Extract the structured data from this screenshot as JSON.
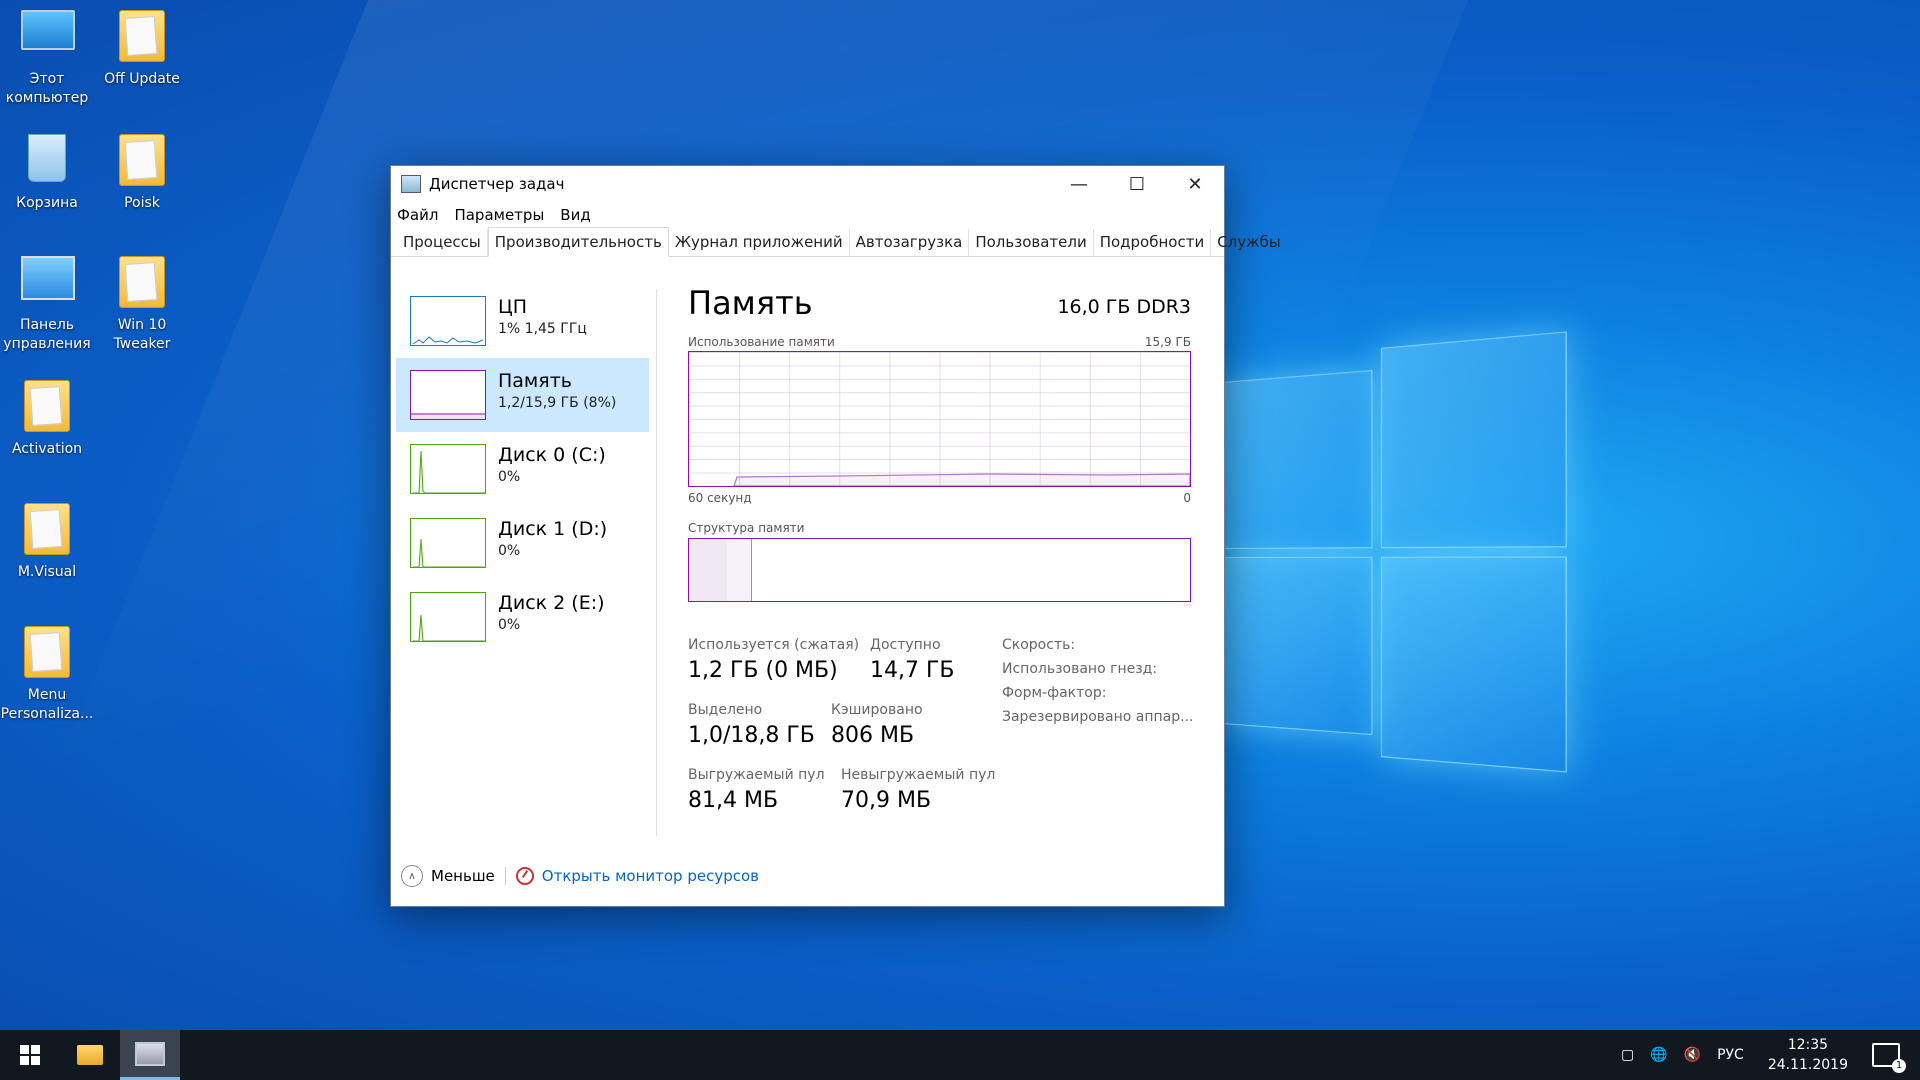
{
  "desktop": {
    "icons": [
      {
        "label": "Этот компьютер",
        "icon": "computer-icon"
      },
      {
        "label": "Off Update",
        "icon": "folder-icon"
      },
      {
        "label": "Корзина",
        "icon": "recycle-bin-icon"
      },
      {
        "label": "Poisk",
        "icon": "folder-icon"
      },
      {
        "label": "Панель управления",
        "icon": "control-panel-icon"
      },
      {
        "label": "Win 10 Tweaker",
        "icon": "folder-icon"
      },
      {
        "label": "Activation",
        "icon": "folder-icon"
      },
      {
        "label": "M.Visual",
        "icon": "folder-icon"
      },
      {
        "label": "Menu Personaliza...",
        "icon": "folder-icon"
      }
    ]
  },
  "window": {
    "title": "Диспетчер задач",
    "menu": [
      "Файл",
      "Параметры",
      "Вид"
    ],
    "tabs": [
      "Процессы",
      "Производительность",
      "Журнал приложений",
      "Автозагрузка",
      "Пользователи",
      "Подробности",
      "Службы"
    ],
    "active_tab": "Производительность",
    "sidebar": [
      {
        "name": "ЦП",
        "sub": "1%  1,45 ГГц"
      },
      {
        "name": "Память",
        "sub": "1,2/15,9 ГБ (8%)"
      },
      {
        "name": "Диск 0 (C:)",
        "sub": "0%"
      },
      {
        "name": "Диск 1 (D:)",
        "sub": "0%"
      },
      {
        "name": "Диск 2 (E:)",
        "sub": "0%"
      }
    ],
    "main": {
      "title": "Память",
      "spec": "16,0 ГБ DDR3",
      "usage_label": "Использование памяти",
      "usage_max": "15,9 ГБ",
      "axis_left": "60 секунд",
      "axis_right": "0",
      "structure_label": "Структура памяти",
      "stats": {
        "in_use_label": "Используется (сжатая)",
        "in_use_value": "1,2 ГБ (0 МБ)",
        "available_label": "Доступно",
        "available_value": "14,7 ГБ",
        "committed_label": "Выделено",
        "committed_value": "1,0/18,8 ГБ",
        "cached_label": "Кэшировано",
        "cached_value": "806 МБ",
        "paged_label": "Выгружаемый пул",
        "paged_value": "81,4 МБ",
        "nonpaged_label": "Невыгружаемый пул",
        "nonpaged_value": "70,9 МБ"
      },
      "props": [
        "Скорость:",
        "Использовано гнезд:",
        "Форм-фактор:",
        "Зарезервировано аппар..."
      ]
    },
    "footer": {
      "less": "Меньше",
      "monitor_link": "Открыть монитор ресурсов"
    }
  },
  "taskbar": {
    "lang": "РУС",
    "time": "12:35",
    "date": "24.11.2019",
    "notifications": "1"
  },
  "colors": {
    "cpu": "#117dbb",
    "memory": "#8b12ae",
    "disk": "#4da60c",
    "selected": "#cce8ff",
    "link": "#0066cc"
  }
}
